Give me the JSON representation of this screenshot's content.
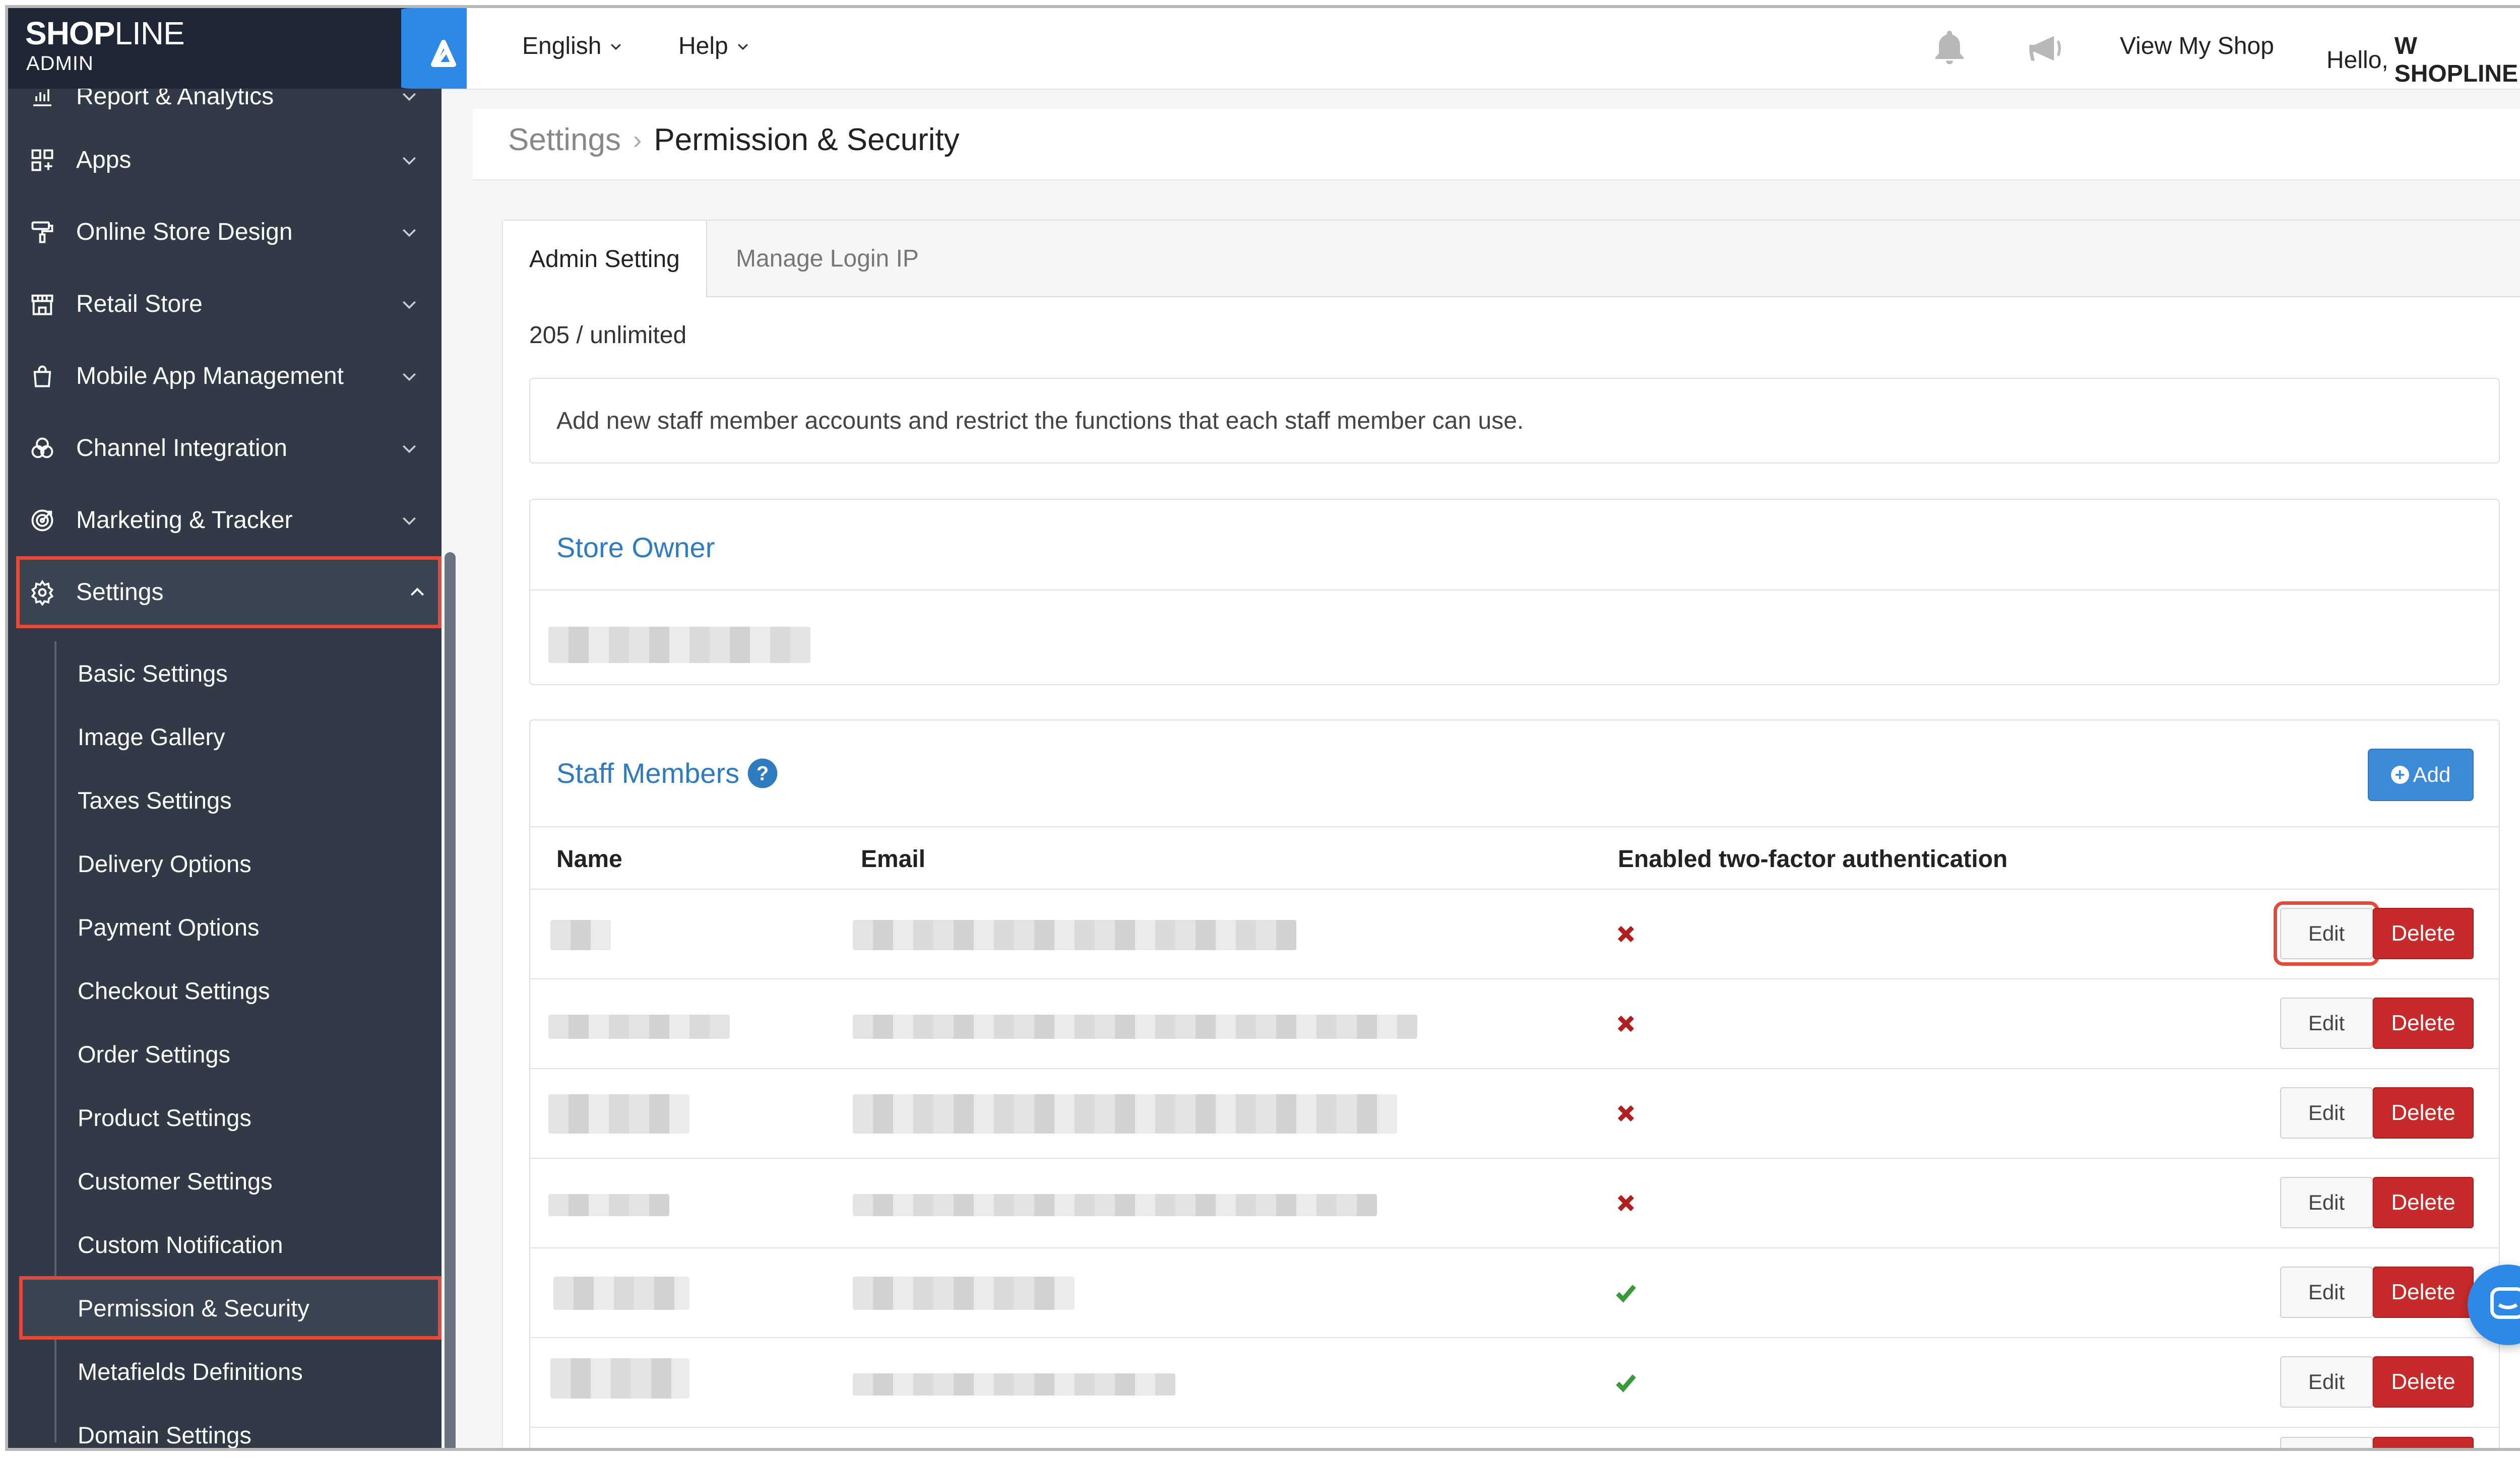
{
  "brand": {
    "logo_main": "SHOP",
    "logo_thin": "LINE",
    "logo_sub": "ADMIN"
  },
  "colors": {
    "sidebar": "#323a48",
    "accent_blue": "#2e7bbf",
    "danger": "#c72a2a",
    "highlight": "#e14b3b"
  },
  "sidebar": {
    "items": [
      {
        "label": "Report & Analytics",
        "icon": "chart-icon"
      },
      {
        "label": "Apps",
        "icon": "apps-icon"
      },
      {
        "label": "Online Store Design",
        "icon": "paint-roller-icon"
      },
      {
        "label": "Retail Store",
        "icon": "store-icon"
      },
      {
        "label": "Mobile App Management",
        "icon": "shopping-bag-icon"
      },
      {
        "label": "Channel Integration",
        "icon": "channels-icon"
      },
      {
        "label": "Marketing & Tracker",
        "icon": "target-icon"
      },
      {
        "label": "Settings",
        "icon": "gear-icon"
      }
    ],
    "settings_sub": [
      "Basic Settings",
      "Image Gallery",
      "Taxes Settings",
      "Delivery Options",
      "Payment Options",
      "Checkout Settings",
      "Order Settings",
      "Product Settings",
      "Customer Settings",
      "Custom Notification",
      "Permission & Security",
      "Metafields Definitions",
      "Domain Settings"
    ]
  },
  "topbar": {
    "language": "English",
    "help": "Help",
    "view_shop": "View My Shop",
    "greeting": "Hello,",
    "user": "W SHOPLINE"
  },
  "breadcrumb": {
    "parent": "Settings",
    "current": "Permission & Security"
  },
  "tabs": [
    "Admin Setting",
    "Manage Login IP"
  ],
  "staff_count": "205 / unlimited",
  "description": "Add new staff member accounts and restrict the functions that each staff member can use.",
  "store_owner": {
    "title": "Store Owner"
  },
  "staff": {
    "title": "Staff Members",
    "add_label": "Add",
    "columns": {
      "name": "Name",
      "email": "Email",
      "tfa": "Enabled two-factor authentication"
    },
    "edit_label": "Edit",
    "delete_label": "Delete",
    "rows": [
      {
        "tfa_enabled": false
      },
      {
        "tfa_enabled": false
      },
      {
        "tfa_enabled": false
      },
      {
        "tfa_enabled": false
      },
      {
        "tfa_enabled": true
      },
      {
        "tfa_enabled": true
      }
    ]
  }
}
